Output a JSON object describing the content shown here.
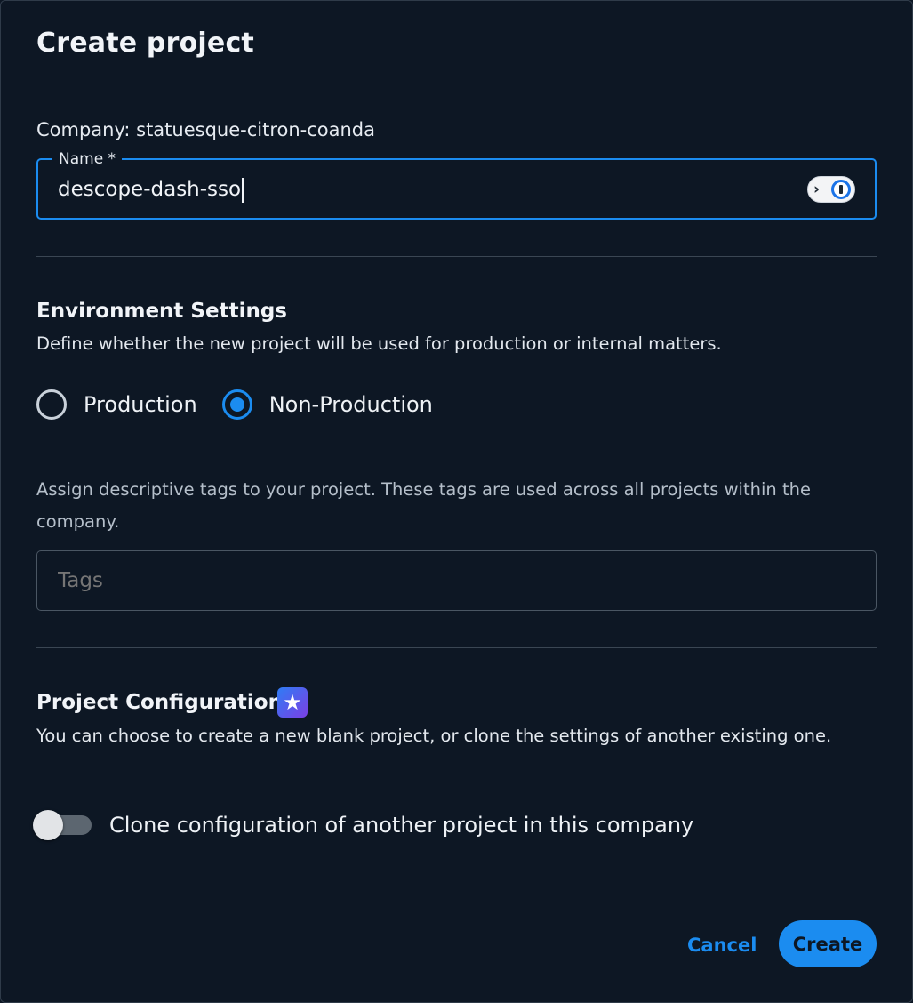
{
  "dialog": {
    "title": "Create project"
  },
  "company_line": "Company: statuesque-citron-coanda",
  "name_field": {
    "label": "Name *",
    "value": "descope-dash-sso",
    "password_manager_icon": "1password-icon"
  },
  "environment": {
    "title": "Environment Settings",
    "description": "Define whether the new project will be used for production or internal matters.",
    "options": [
      {
        "label": "Production",
        "selected": false
      },
      {
        "label": "Non-Production",
        "selected": true
      }
    ]
  },
  "tags": {
    "description": "Assign descriptive tags to your project. These tags are used across all projects within the company.",
    "placeholder": "Tags"
  },
  "configuration": {
    "title": "Project Configuration",
    "badge_icon": "star-icon",
    "badge_glyph": "★",
    "description": "You can choose to create a new blank project, or clone the settings of another existing one.",
    "clone_toggle": {
      "label": "Clone configuration of another project in this company",
      "enabled": false
    }
  },
  "actions": {
    "cancel_label": "Cancel",
    "create_label": "Create"
  },
  "colors": {
    "background": "#0d1724",
    "accent": "#1b8cf0"
  }
}
